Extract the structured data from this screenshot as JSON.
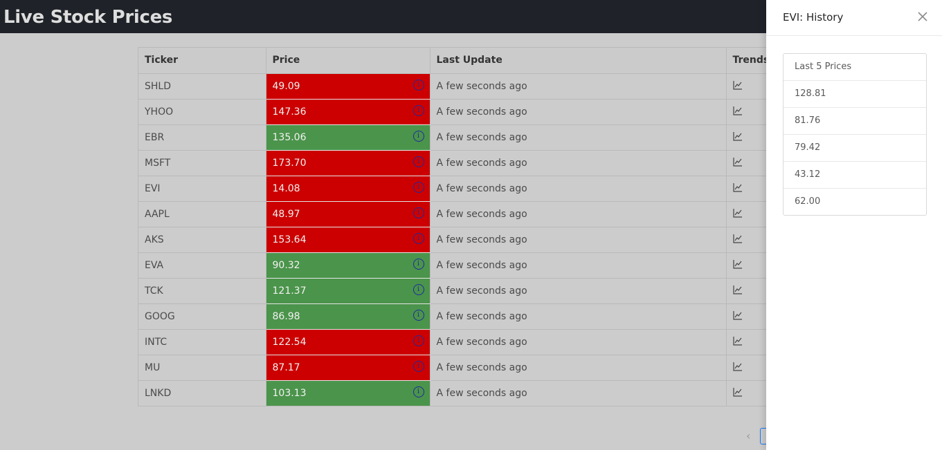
{
  "app": {
    "title": "Live Stock Prices"
  },
  "table": {
    "headers": {
      "ticker": "Ticker",
      "price": "Price",
      "last_update": "Last Update",
      "trends": "Trends"
    },
    "rows": [
      {
        "ticker": "SHLD",
        "price": "49.09",
        "direction": "down",
        "last_update": "A few seconds ago"
      },
      {
        "ticker": "YHOO",
        "price": "147.36",
        "direction": "down",
        "last_update": "A few seconds ago"
      },
      {
        "ticker": "EBR",
        "price": "135.06",
        "direction": "up",
        "last_update": "A few seconds ago"
      },
      {
        "ticker": "MSFT",
        "price": "173.70",
        "direction": "down",
        "last_update": "A few seconds ago"
      },
      {
        "ticker": "EVI",
        "price": "14.08",
        "direction": "down",
        "last_update": "A few seconds ago"
      },
      {
        "ticker": "AAPL",
        "price": "48.97",
        "direction": "down",
        "last_update": "A few seconds ago"
      },
      {
        "ticker": "AKS",
        "price": "153.64",
        "direction": "down",
        "last_update": "A few seconds ago"
      },
      {
        "ticker": "EVA",
        "price": "90.32",
        "direction": "up",
        "last_update": "A few seconds ago"
      },
      {
        "ticker": "TCK",
        "price": "121.37",
        "direction": "up",
        "last_update": "A few seconds ago"
      },
      {
        "ticker": "GOOG",
        "price": "86.98",
        "direction": "up",
        "last_update": "A few seconds ago"
      },
      {
        "ticker": "INTC",
        "price": "122.54",
        "direction": "down",
        "last_update": "A few seconds ago"
      },
      {
        "ticker": "MU",
        "price": "87.17",
        "direction": "down",
        "last_update": "A few seconds ago"
      },
      {
        "ticker": "LNKD",
        "price": "103.13",
        "direction": "up",
        "last_update": "A few seconds ago"
      }
    ]
  },
  "pagination": {
    "prev_icon": "chevron-left-icon"
  },
  "drawer": {
    "title": "EVI: History",
    "close_icon": "close-icon",
    "history_header": "Last 5 Prices",
    "history": [
      "128.81",
      "81.76",
      "79.42",
      "43.12",
      "62.00"
    ]
  },
  "colors": {
    "price_down": "#cc0000",
    "price_up": "#4b944b",
    "topbar": "#1f2329"
  },
  "icons": {
    "info": "info-icon",
    "trend": "line-chart-icon"
  }
}
